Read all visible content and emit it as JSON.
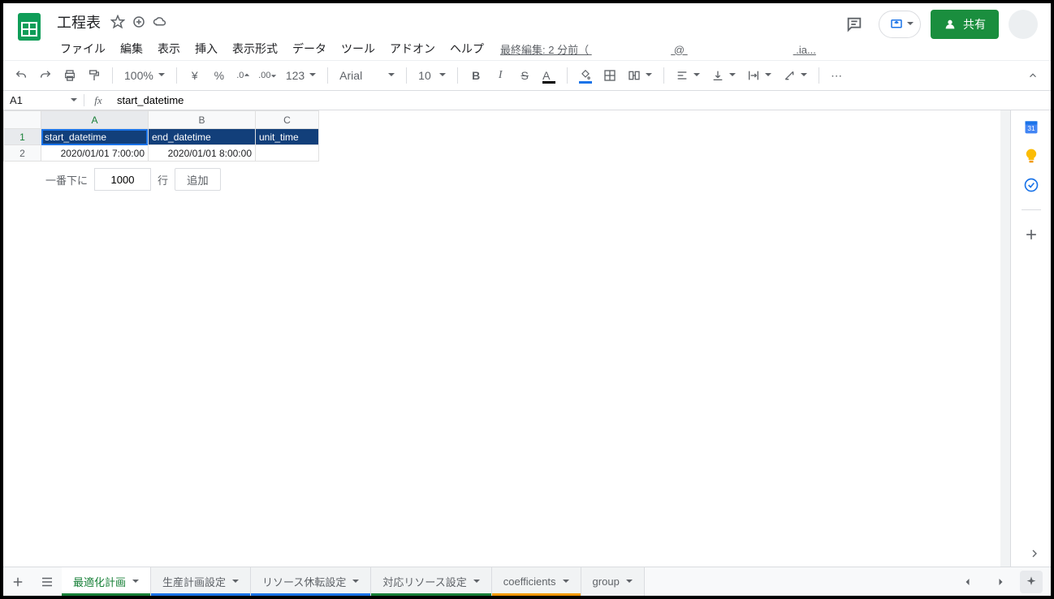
{
  "doc": {
    "title": "工程表"
  },
  "menus": [
    "ファイル",
    "編集",
    "表示",
    "挿入",
    "表示形式",
    "データ",
    "ツール",
    "アドオン",
    "ヘルプ"
  ],
  "last_edit_prefix": "最終編集: 2 分前（",
  "last_edit_suffix": ".ia...",
  "last_edit_email": "@",
  "share_label": "共有",
  "toolbar": {
    "zoom": "100%",
    "currency": "¥",
    "percent": "%",
    "dec_dec": ".0",
    "inc_dec": ".00",
    "numfmt": "123",
    "font": "Arial",
    "size": "10",
    "more": "⋯"
  },
  "namebox": "A1",
  "formula": "start_datetime",
  "columns": [
    "A",
    "B",
    "C"
  ],
  "rows": [
    {
      "n": "1",
      "cells": [
        "start_datetime",
        "end_datetime",
        "unit_time"
      ],
      "hdr": true
    },
    {
      "n": "2",
      "cells": [
        "2020/01/01 7:00:00",
        "2020/01/01 8:00:00",
        ""
      ],
      "hdr": false
    }
  ],
  "add_rows": {
    "pre": "一番下に",
    "count": "1000",
    "post": "行",
    "btn": "追加"
  },
  "tabs": [
    {
      "label": "最適化計画",
      "color": "#188038",
      "active": true
    },
    {
      "label": "生産計画設定",
      "color": "#1a73e8",
      "active": false
    },
    {
      "label": "リソース休転設定",
      "color": "#1a73e8",
      "active": false
    },
    {
      "label": "対応リソース設定",
      "color": "#188038",
      "active": false
    },
    {
      "label": "coefficients",
      "color": "#f29900",
      "active": false
    },
    {
      "label": "group",
      "color": "",
      "active": false
    }
  ]
}
